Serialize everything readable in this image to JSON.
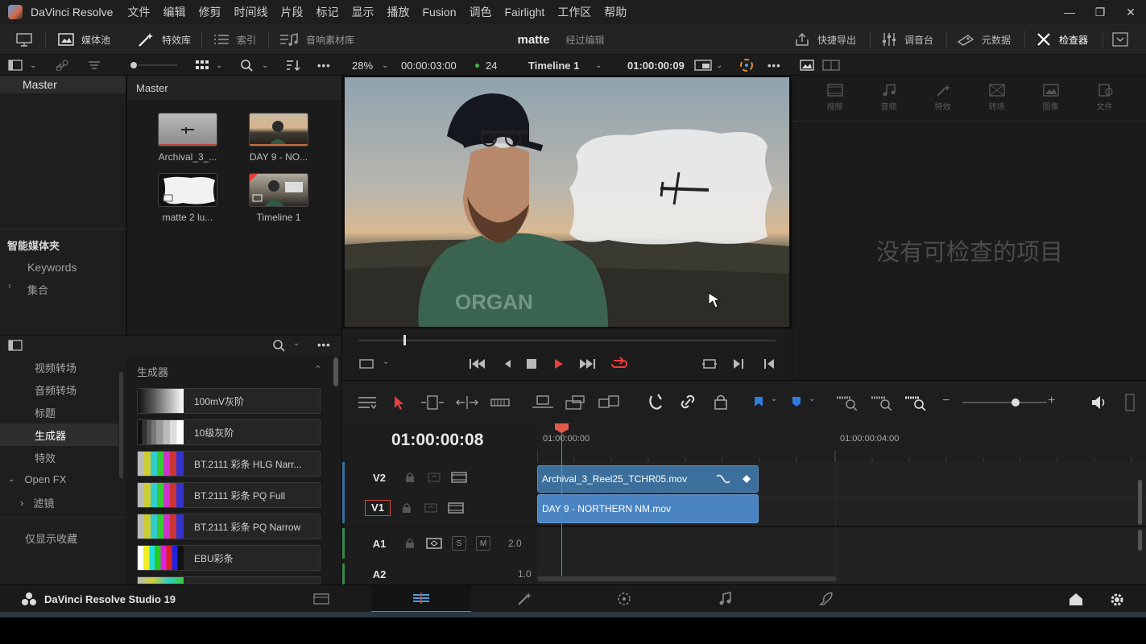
{
  "app": {
    "title": "DaVinci Resolve",
    "menu": [
      "文件",
      "编辑",
      "修剪",
      "时间线",
      "片段",
      "标记",
      "显示",
      "播放",
      "Fusion",
      "调色",
      "Fairlight",
      "工作区",
      "帮助"
    ]
  },
  "toolbar": {
    "media_pool": "媒体池",
    "effects": "特效库",
    "index": "索引",
    "sound_library": "音响素材库",
    "project_name": "matte",
    "project_status": "经过编辑",
    "quick_export": "快捷导出",
    "mixer": "调音台",
    "metadata": "元数据",
    "inspector": "检查器"
  },
  "viewer_bar": {
    "zoom": "28%",
    "source_duration": "00:00:03:00",
    "fps": "24",
    "timeline_name": "Timeline 1",
    "timecode": "01:00:00:09"
  },
  "bins": {
    "master": "Master",
    "smart_bins_title": "智能媒体夹",
    "smart_items": [
      "Keywords",
      "集合"
    ]
  },
  "media_pool": {
    "path": "Master",
    "clips": [
      {
        "name": "Archival_3_..."
      },
      {
        "name": "DAY 9 - NO..."
      },
      {
        "name": "matte 2 lu..."
      },
      {
        "name": "Timeline 1"
      }
    ]
  },
  "inspector": {
    "tabs": [
      "视频",
      "音频",
      "特效",
      "转场",
      "图像",
      "文件"
    ],
    "empty_message": "没有可检查的项目"
  },
  "effects": {
    "categories": [
      "视频转场",
      "音频转场",
      "标题",
      "生成器",
      "特效",
      "Open FX",
      "滤镜",
      "仅显示收藏"
    ],
    "section_title": "生成器",
    "items": [
      "100mV灰阶",
      "10级灰阶",
      "BT.2111 彩条 HLG Narr...",
      "BT.2111 彩条 PQ Full",
      "BT.2111 彩条 PQ Narrow",
      "EBU彩条"
    ]
  },
  "timeline": {
    "timecode": "01:00:00:08",
    "ruler": [
      "01:00:00:00",
      "01:00:00:04:00"
    ],
    "tracks": [
      {
        "name": "V2"
      },
      {
        "name": "V1"
      },
      {
        "name": "A1",
        "level": "2.0"
      },
      {
        "name": "A2",
        "level": "1.0"
      }
    ],
    "clips": {
      "v2": "Archival_3_Reel25_TCHR05.mov",
      "v1": "DAY 9 - NORTHERN NM.mov"
    },
    "solo": "S",
    "mute": "M"
  },
  "footer": {
    "brand": "DaVinci Resolve Studio 19"
  },
  "colors": {
    "accent_red": "#e8403a",
    "clip_blue": "#3f7fb5",
    "playhead": "#e25a4a"
  }
}
